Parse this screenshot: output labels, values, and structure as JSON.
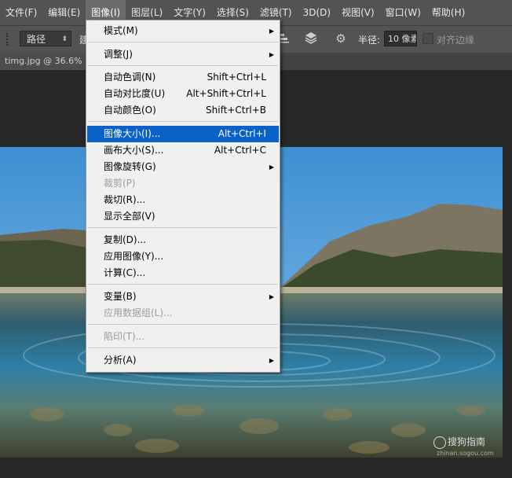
{
  "menubar": {
    "items": [
      "文件(F)",
      "编辑(E)",
      "图像(I)",
      "图层(L)",
      "文字(Y)",
      "选择(S)",
      "滤镜(T)",
      "3D(D)",
      "视图(V)",
      "窗口(W)",
      "帮助(H)"
    ],
    "active_index": 2
  },
  "options": {
    "path_mode": "路径",
    "cut_text": "建",
    "radius_label": "半径:",
    "radius_value": "10 像素",
    "align_edges_label": "对齐边缘",
    "align_edges_checked": false
  },
  "document": {
    "tab_title": "timg.jpg @ 36.6%"
  },
  "image_menu": {
    "items": [
      {
        "label": "模式(M)",
        "shortcut": "",
        "submenu": true,
        "disabled": false
      },
      {
        "label": "调整(J)",
        "shortcut": "",
        "submenu": true,
        "disabled": false
      },
      {
        "label": "自动色调(N)",
        "shortcut": "Shift+Ctrl+L",
        "submenu": false,
        "disabled": false
      },
      {
        "label": "自动对比度(U)",
        "shortcut": "Alt+Shift+Ctrl+L",
        "submenu": false,
        "disabled": false
      },
      {
        "label": "自动颜色(O)",
        "shortcut": "Shift+Ctrl+B",
        "submenu": false,
        "disabled": false
      },
      {
        "label": "图像大小(I)...",
        "shortcut": "Alt+Ctrl+I",
        "submenu": false,
        "disabled": false,
        "highlighted": true
      },
      {
        "label": "画布大小(S)...",
        "shortcut": "Alt+Ctrl+C",
        "submenu": false,
        "disabled": false
      },
      {
        "label": "图像旋转(G)",
        "shortcut": "",
        "submenu": true,
        "disabled": false
      },
      {
        "label": "裁剪(P)",
        "shortcut": "",
        "submenu": false,
        "disabled": true
      },
      {
        "label": "裁切(R)...",
        "shortcut": "",
        "submenu": false,
        "disabled": false
      },
      {
        "label": "显示全部(V)",
        "shortcut": "",
        "submenu": false,
        "disabled": false
      },
      {
        "label": "复制(D)...",
        "shortcut": "",
        "submenu": false,
        "disabled": false
      },
      {
        "label": "应用图像(Y)...",
        "shortcut": "",
        "submenu": false,
        "disabled": false
      },
      {
        "label": "计算(C)...",
        "shortcut": "",
        "submenu": false,
        "disabled": false
      },
      {
        "label": "变量(B)",
        "shortcut": "",
        "submenu": true,
        "disabled": false
      },
      {
        "label": "应用数据组(L)...",
        "shortcut": "",
        "submenu": false,
        "disabled": true
      },
      {
        "label": "陷印(T)...",
        "shortcut": "",
        "submenu": false,
        "disabled": true
      },
      {
        "label": "分析(A)",
        "shortcut": "",
        "submenu": true,
        "disabled": false
      }
    ]
  },
  "watermark": {
    "brand": "搜狗指南",
    "url": "zhinan.sogou.com"
  },
  "colors": {
    "ui_panel": "#535353",
    "canvas_bg": "#282828",
    "menu_bg": "#f0f0f0",
    "highlight": "#0a62c8"
  },
  "icons": {
    "submenu_arrow": "triangle-right-icon",
    "settings": "gear-icon",
    "arrange": "stack-icon"
  }
}
